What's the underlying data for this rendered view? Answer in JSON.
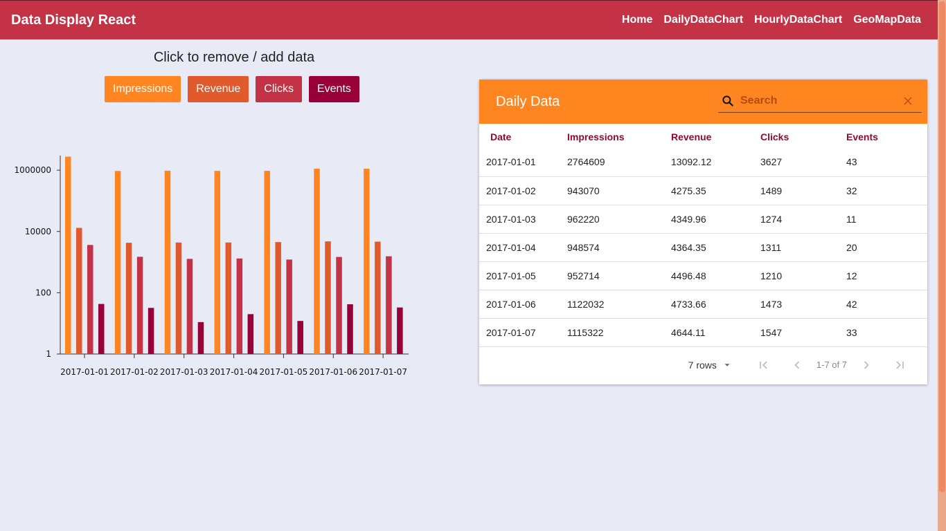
{
  "appbar": {
    "title": "Data Display React",
    "nav": [
      "Home",
      "DailyDataChart",
      "HourlyDataChart",
      "GeoMapData"
    ]
  },
  "instruction": "Click to remove / add data",
  "toggle_buttons": [
    {
      "label": "Impressions",
      "color": "#ff8520"
    },
    {
      "label": "Revenue",
      "color": "#e05a2b"
    },
    {
      "label": "Clicks",
      "color": "#c33345"
    },
    {
      "label": "Events",
      "color": "#970137"
    }
  ],
  "chart_data": {
    "type": "bar",
    "scale": "log",
    "categories": [
      "2017-01-01",
      "2017-01-02",
      "2017-01-03",
      "2017-01-04",
      "2017-01-05",
      "2017-01-06",
      "2017-01-07"
    ],
    "yticks": [
      "1",
      "100",
      "10000",
      "1000000"
    ],
    "series": [
      {
        "name": "Impressions",
        "color": "#ff8520",
        "values": [
          2764609,
          943070,
          962220,
          948574,
          952714,
          1122032,
          1115322
        ]
      },
      {
        "name": "Revenue",
        "color": "#e05a2b",
        "values": [
          13092.12,
          4275.35,
          4349.96,
          4364.35,
          4496.48,
          4733.66,
          4644.11
        ]
      },
      {
        "name": "Clicks",
        "color": "#c33345",
        "values": [
          3627,
          1489,
          1274,
          1311,
          1210,
          1473,
          1547
        ]
      },
      {
        "name": "Events",
        "color": "#970137",
        "values": [
          43,
          32,
          11,
          20,
          12,
          42,
          33
        ]
      }
    ],
    "ylim": [
      1,
      3000000
    ]
  },
  "table": {
    "title": "Daily Data",
    "search_placeholder": "Search",
    "columns": [
      "Date",
      "Impressions",
      "Revenue",
      "Clicks",
      "Events"
    ],
    "rows": [
      [
        "2017-01-01",
        "2764609",
        "13092.12",
        "3627",
        "43"
      ],
      [
        "2017-01-02",
        "943070",
        "4275.35",
        "1489",
        "32"
      ],
      [
        "2017-01-03",
        "962220",
        "4349.96",
        "1274",
        "11"
      ],
      [
        "2017-01-04",
        "948574",
        "4364.35",
        "1311",
        "20"
      ],
      [
        "2017-01-05",
        "952714",
        "4496.48",
        "1210",
        "12"
      ],
      [
        "2017-01-06",
        "1122032",
        "4733.66",
        "1473",
        "42"
      ],
      [
        "2017-01-07",
        "1115322",
        "4644.11",
        "1547",
        "33"
      ]
    ],
    "footer": {
      "rows_per_page": "7 rows",
      "range": "1-7 of 7"
    }
  }
}
